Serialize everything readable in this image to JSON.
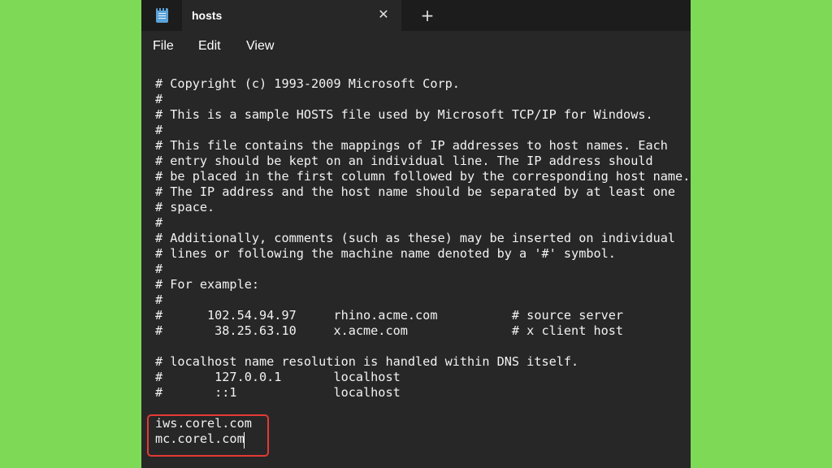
{
  "window": {
    "tab_title": "hosts",
    "close_glyph": "✕",
    "new_tab_glyph": "+"
  },
  "menu": {
    "items": [
      "File",
      "Edit",
      "View"
    ]
  },
  "editor": {
    "lines": [
      "# Copyright (c) 1993-2009 Microsoft Corp.",
      "#",
      "# This is a sample HOSTS file used by Microsoft TCP/IP for Windows.",
      "#",
      "# This file contains the mappings of IP addresses to host names. Each",
      "# entry should be kept on an individual line. The IP address should",
      "# be placed in the first column followed by the corresponding host name.",
      "# The IP address and the host name should be separated by at least one",
      "# space.",
      "#",
      "# Additionally, comments (such as these) may be inserted on individual",
      "# lines or following the machine name denoted by a '#' symbol.",
      "#",
      "# For example:",
      "#",
      "#      102.54.94.97     rhino.acme.com          # source server",
      "#       38.25.63.10     x.acme.com              # x client host",
      "",
      "# localhost name resolution is handled within DNS itself.",
      "#       127.0.0.1       localhost",
      "#       ::1             localhost",
      "",
      "iws.corel.com",
      "mc.corel.com"
    ]
  },
  "colors": {
    "background": "#7ed957",
    "editor_bg": "#272727",
    "titlebar_bg": "#1c1c1c",
    "highlight": "#e53935"
  }
}
